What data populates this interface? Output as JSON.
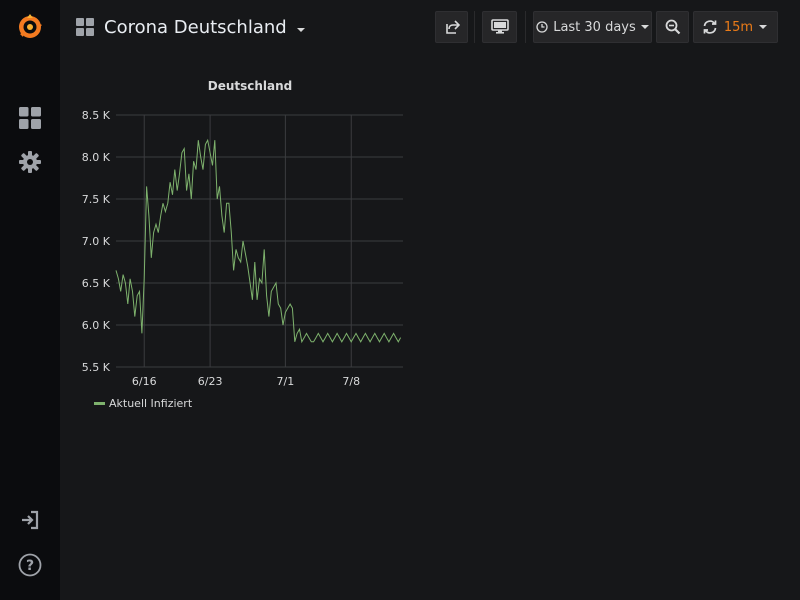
{
  "dashboard": {
    "title": "Corona Deutschland"
  },
  "toolbar": {
    "time_range_label": "Last 30 days",
    "refresh_interval": "15m"
  },
  "colors": {
    "accent": "#eb7b18",
    "series": "#7eb26d",
    "grid": "#3b3c3f"
  },
  "chart_data": {
    "type": "line",
    "title": "Deutschland",
    "ylim": [
      5500,
      8500
    ],
    "y_ticks": [
      5500,
      6000,
      6500,
      7000,
      7500,
      8000,
      8500
    ],
    "y_tick_labels": [
      "5.5 K",
      "6.0 K",
      "6.5 K",
      "7.0 K",
      "7.5 K",
      "8.0 K",
      "8.5 K"
    ],
    "xlim": [
      "2020-06-13",
      "2020-07-13"
    ],
    "x_ticks": [
      "2020-06-16",
      "2020-06-23",
      "2020-07-01",
      "2020-07-08"
    ],
    "x_tick_labels": [
      "6/16",
      "6/23",
      "7/1",
      "7/8"
    ],
    "legend_position": "bottom-left",
    "series": [
      {
        "name": "Aktuell Infiziert",
        "x": [
          "2020-06-13 00:00",
          "2020-06-13 06:00",
          "2020-06-13 12:00",
          "2020-06-13 18:00",
          "2020-06-14 00:00",
          "2020-06-14 06:00",
          "2020-06-14 12:00",
          "2020-06-14 18:00",
          "2020-06-15 00:00",
          "2020-06-15 06:00",
          "2020-06-15 12:00",
          "2020-06-15 18:00",
          "2020-06-16 00:00",
          "2020-06-16 06:00",
          "2020-06-16 12:00",
          "2020-06-16 18:00",
          "2020-06-17 00:00",
          "2020-06-17 06:00",
          "2020-06-17 12:00",
          "2020-06-17 18:00",
          "2020-06-18 00:00",
          "2020-06-18 06:00",
          "2020-06-18 12:00",
          "2020-06-18 18:00",
          "2020-06-19 00:00",
          "2020-06-19 06:00",
          "2020-06-19 12:00",
          "2020-06-19 18:00",
          "2020-06-20 00:00",
          "2020-06-20 06:00",
          "2020-06-20 12:00",
          "2020-06-20 18:00",
          "2020-06-21 00:00",
          "2020-06-21 06:00",
          "2020-06-21 12:00",
          "2020-06-21 18:00",
          "2020-06-22 00:00",
          "2020-06-22 06:00",
          "2020-06-22 12:00",
          "2020-06-22 18:00",
          "2020-06-23 00:00",
          "2020-06-23 06:00",
          "2020-06-23 12:00",
          "2020-06-23 18:00",
          "2020-06-24 00:00",
          "2020-06-24 06:00",
          "2020-06-24 12:00",
          "2020-06-24 18:00",
          "2020-06-25 00:00",
          "2020-06-25 06:00",
          "2020-06-25 12:00",
          "2020-06-25 18:00",
          "2020-06-26 00:00",
          "2020-06-26 06:00",
          "2020-06-26 12:00",
          "2020-06-26 18:00",
          "2020-06-27 00:00",
          "2020-06-27 06:00",
          "2020-06-27 12:00",
          "2020-06-27 18:00",
          "2020-06-28 00:00",
          "2020-06-28 06:00",
          "2020-06-28 12:00",
          "2020-06-28 18:00",
          "2020-06-29 00:00",
          "2020-06-29 06:00",
          "2020-06-29 12:00",
          "2020-06-29 18:00",
          "2020-06-30 00:00",
          "2020-06-30 06:00",
          "2020-06-30 12:00",
          "2020-06-30 18:00",
          "2020-07-01 00:00",
          "2020-07-01 06:00",
          "2020-07-01 12:00",
          "2020-07-01 18:00",
          "2020-07-02 00:00",
          "2020-07-02 06:00",
          "2020-07-02 12:00",
          "2020-07-02 18:00",
          "2020-07-03 00:00",
          "2020-07-03 06:00",
          "2020-07-03 12:00",
          "2020-07-03 18:00",
          "2020-07-04 00:00",
          "2020-07-04 06:00",
          "2020-07-04 12:00",
          "2020-07-04 18:00",
          "2020-07-05 00:00",
          "2020-07-05 06:00",
          "2020-07-05 12:00",
          "2020-07-05 18:00",
          "2020-07-06 00:00",
          "2020-07-06 06:00",
          "2020-07-06 12:00",
          "2020-07-06 18:00",
          "2020-07-07 00:00",
          "2020-07-07 06:00",
          "2020-07-07 12:00",
          "2020-07-07 18:00",
          "2020-07-08 00:00",
          "2020-07-08 06:00",
          "2020-07-08 12:00",
          "2020-07-08 18:00",
          "2020-07-09 00:00",
          "2020-07-09 06:00",
          "2020-07-09 12:00",
          "2020-07-09 18:00",
          "2020-07-10 00:00",
          "2020-07-10 06:00",
          "2020-07-10 12:00",
          "2020-07-10 18:00",
          "2020-07-11 00:00",
          "2020-07-11 06:00",
          "2020-07-11 12:00",
          "2020-07-11 18:00",
          "2020-07-12 00:00",
          "2020-07-12 06:00",
          "2020-07-12 12:00",
          "2020-07-12 18:00",
          "2020-07-13 00:00",
          "2020-07-13 06:00"
        ],
        "values": [
          6650,
          6550,
          6400,
          6600,
          6500,
          6250,
          6550,
          6400,
          6100,
          6350,
          6400,
          5900,
          6550,
          7650,
          7300,
          6800,
          7100,
          7200,
          7100,
          7300,
          7450,
          7350,
          7450,
          7700,
          7550,
          7850,
          7600,
          7800,
          8050,
          8100,
          7600,
          7800,
          7500,
          7950,
          7850,
          8200,
          8000,
          7850,
          8150,
          8200,
          8050,
          7900,
          8200,
          7500,
          7650,
          7300,
          7100,
          7450,
          7450,
          7100,
          6650,
          6900,
          6800,
          6750,
          7000,
          6850,
          6700,
          6500,
          6300,
          6750,
          6300,
          6550,
          6500,
          6900,
          6350,
          6100,
          6400,
          6450,
          6500,
          6250,
          6200,
          6000,
          6150,
          6200,
          6250,
          6200,
          5800,
          5900,
          5950,
          5800,
          5850,
          5900,
          5850,
          5800,
          5800,
          5850,
          5900,
          5850,
          5800,
          5850,
          5900,
          5850,
          5800,
          5850,
          5900,
          5850,
          5800,
          5850,
          5900,
          5850,
          5800,
          5850,
          5900,
          5850,
          5800,
          5850,
          5900,
          5850,
          5800,
          5850,
          5900,
          5850,
          5800,
          5850,
          5900,
          5850,
          5800,
          5850,
          5900,
          5850,
          5800,
          5850
        ]
      }
    ]
  }
}
